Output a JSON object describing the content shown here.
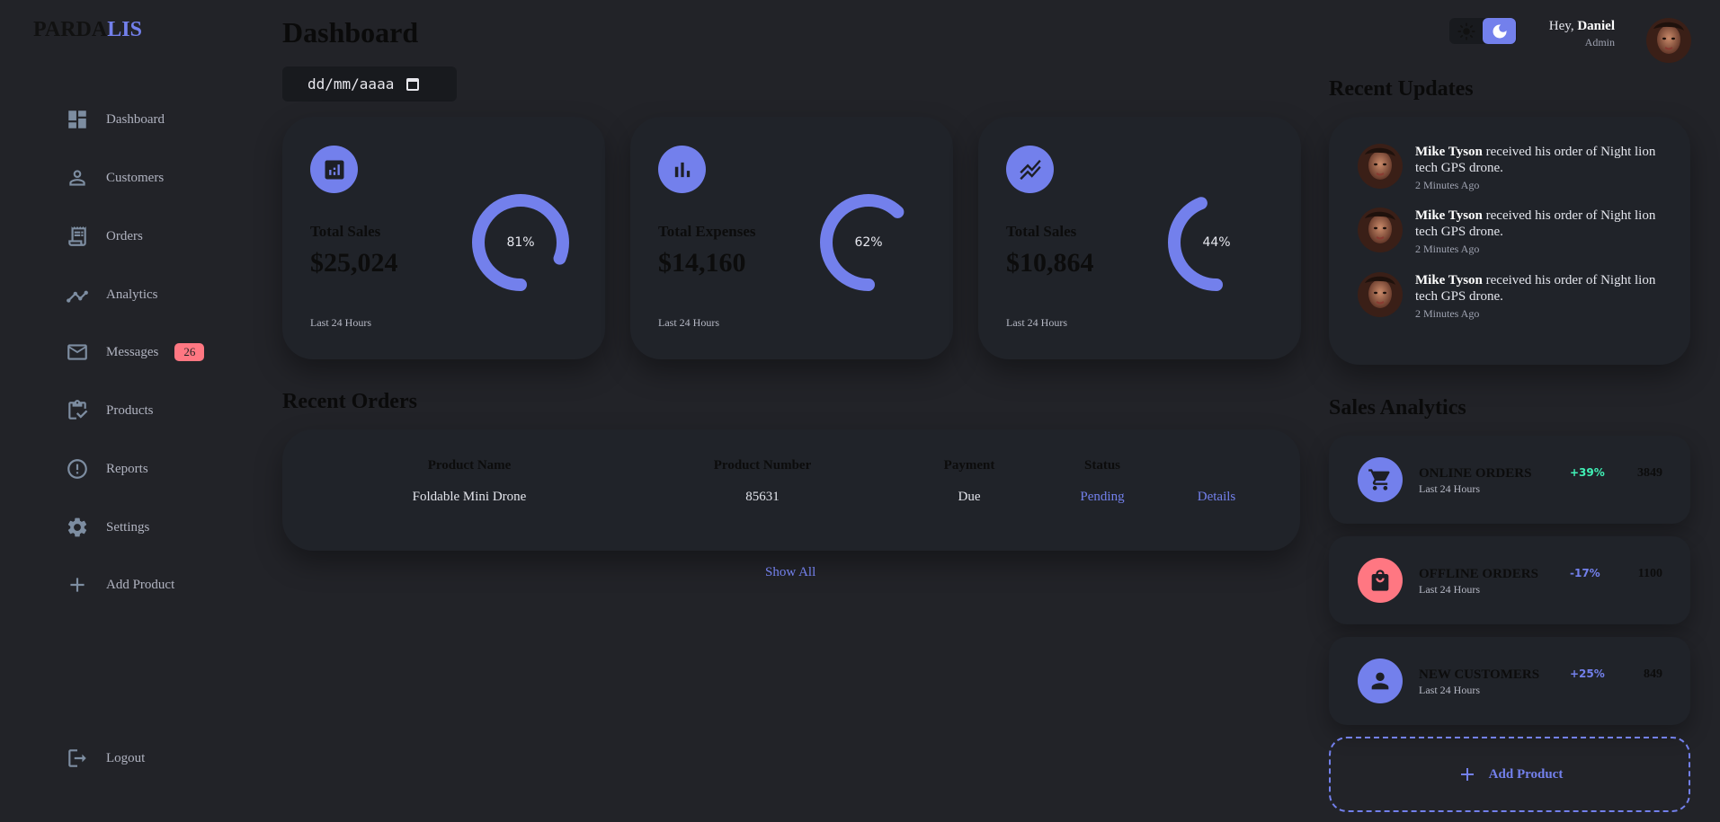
{
  "brand": {
    "first": "PARDA",
    "second": "LIS"
  },
  "sidebar": {
    "items": [
      {
        "label": "Dashboard",
        "icon": "dashboard-icon"
      },
      {
        "label": "Customers",
        "icon": "person-icon"
      },
      {
        "label": "Orders",
        "icon": "receipt-icon"
      },
      {
        "label": "Analytics",
        "icon": "insights-icon"
      },
      {
        "label": "Messages",
        "icon": "mail-icon",
        "badge": "26"
      },
      {
        "label": "Products",
        "icon": "inventory-icon"
      },
      {
        "label": "Reports",
        "icon": "report-icon"
      },
      {
        "label": "Settings",
        "icon": "settings-icon"
      },
      {
        "label": "Add Product",
        "icon": "add-icon"
      }
    ],
    "logout": "Logout"
  },
  "header": {
    "title": "Dashboard",
    "date_placeholder": "dd/mm/aaaa"
  },
  "cards": [
    {
      "label": "Total Sales",
      "amount": "$25,024",
      "percent_text": "81%",
      "percent": 81,
      "sub": "Last 24 Hours",
      "icon": "analytics-icon"
    },
    {
      "label": "Total Expenses",
      "amount": "$14,160",
      "percent_text": "62%",
      "percent": 62,
      "sub": "Last 24 Hours",
      "icon": "bar-chart-icon"
    },
    {
      "label": "Total Sales",
      "amount": "$10,864",
      "percent_text": "44%",
      "percent": 44,
      "sub": "Last 24 Hours",
      "icon": "stacked-line-icon"
    }
  ],
  "recent_orders": {
    "title": "Recent Orders",
    "headers": [
      "Product Name",
      "Product Number",
      "Payment",
      "Status"
    ],
    "rows": [
      {
        "name": "Foldable Mini Drone",
        "number": "85631",
        "payment": "Due",
        "status": "Pending",
        "action": "Details"
      }
    ],
    "show_all": "Show All"
  },
  "profile": {
    "greeting": "Hey,",
    "name": "Daniel",
    "role": "Admin"
  },
  "theme_toggle": {
    "light_icon": "sun-icon",
    "dark_icon": "moon-icon",
    "active": "dark"
  },
  "recent_updates": {
    "title": "Recent Updates",
    "items": [
      {
        "name": "Mike Tyson",
        "text": "received his order of Night lion tech GPS drone.",
        "time": "2 Minutes Ago"
      },
      {
        "name": "Mike Tyson",
        "text": "received his order of Night lion tech GPS drone.",
        "time": "2 Minutes Ago"
      },
      {
        "name": "Mike Tyson",
        "text": "received his order of Night lion tech GPS drone.",
        "time": "2 Minutes Ago"
      }
    ]
  },
  "sales_analytics": {
    "title": "Sales Analytics",
    "items": [
      {
        "name": "ONLINE ORDERS",
        "sub": "Last 24 Hours",
        "pct": "+39%",
        "count": "3849",
        "icon": "cart-icon",
        "color": "#7380ec",
        "pct_color": "#41f1b6"
      },
      {
        "name": "OFFLINE ORDERS",
        "sub": "Last 24 Hours",
        "pct": "-17%",
        "count": "1100",
        "icon": "shopping-bag-icon",
        "color": "#ff7782",
        "pct_color": "#7380ec"
      },
      {
        "name": "NEW CUSTOMERS",
        "sub": "Last 24 Hours",
        "pct": "+25%",
        "count": "849",
        "icon": "person-icon",
        "color": "#7380ec",
        "pct_color": "#7380ec"
      }
    ],
    "add_product": "Add Product"
  },
  "colors": {
    "primary": "#7380ec",
    "danger": "#ff7782",
    "success": "#41f1b6",
    "background": "#222328",
    "card": "#202329"
  }
}
